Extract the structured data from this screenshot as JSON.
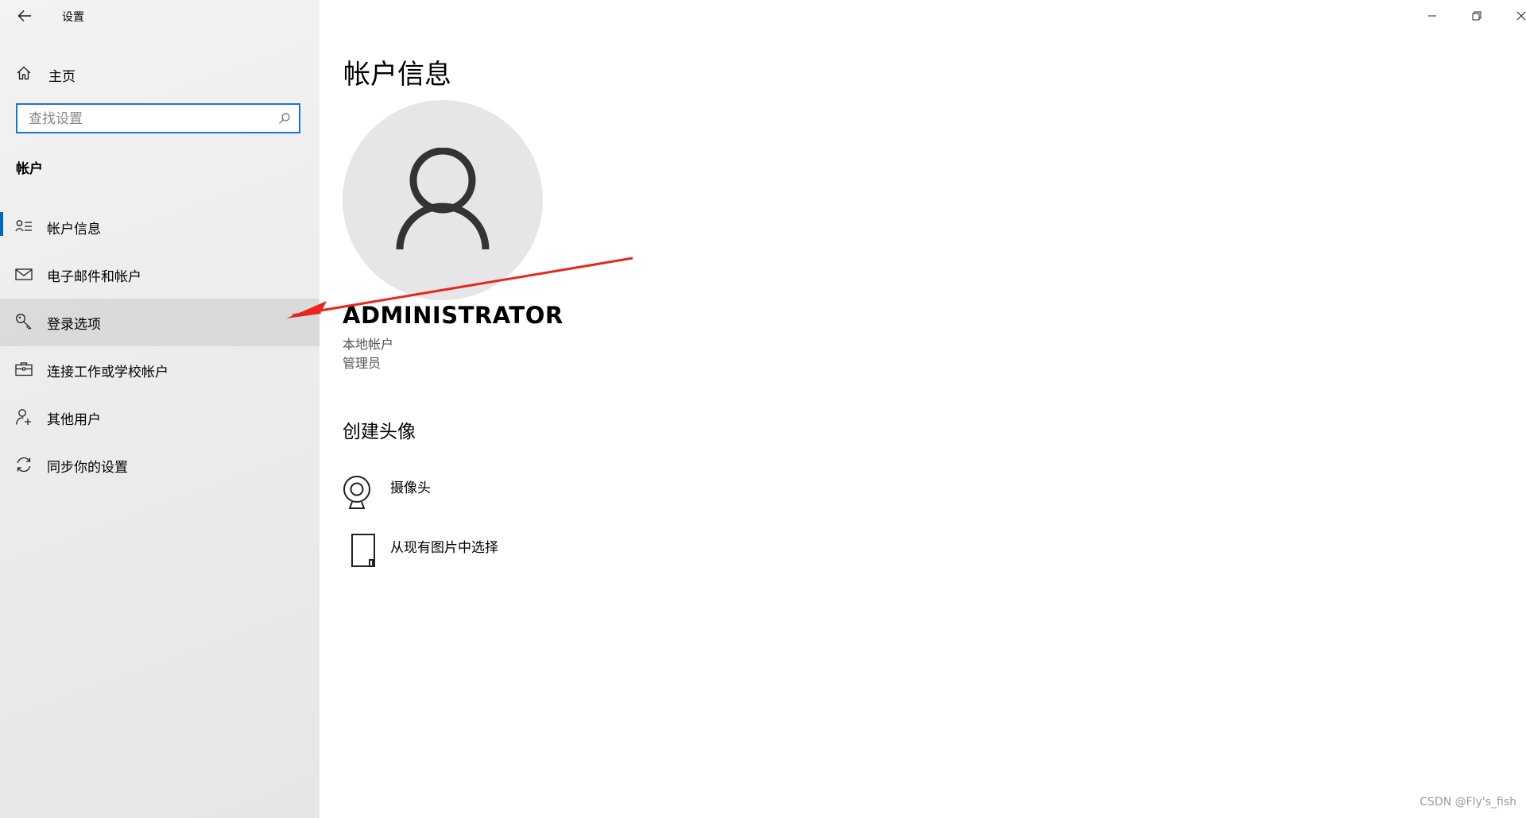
{
  "window": {
    "app_title": "设置",
    "controls": [
      "minimize-icon",
      "restore-icon",
      "close-icon"
    ]
  },
  "sidebar": {
    "home_label": "主页",
    "search": {
      "placeholder": "查找设置",
      "value": ""
    },
    "section_label": "帐户",
    "items": [
      {
        "label": "帐户信息",
        "icon": "account-info-icon",
        "selected": true
      },
      {
        "label": "电子邮件和帐户",
        "icon": "mail-icon"
      },
      {
        "label": "登录选项",
        "icon": "key-icon",
        "hover": true
      },
      {
        "label": "连接工作或学校帐户",
        "icon": "briefcase-icon"
      },
      {
        "label": "其他用户",
        "icon": "person-add-icon"
      },
      {
        "label": "同步你的设置",
        "icon": "sync-icon"
      }
    ]
  },
  "main": {
    "title": "帐户信息",
    "user": {
      "name": "ADMINISTRATOR",
      "account_type": "本地帐户",
      "role": "管理员"
    },
    "avatar_section": {
      "heading": "创建头像",
      "options": [
        {
          "label": "摄像头",
          "icon": "webcam-icon"
        },
        {
          "label": "从现有图片中选择",
          "icon": "picture-file-icon"
        }
      ]
    }
  },
  "watermark": "CSDN @Fly's_fish",
  "colors": {
    "accent": "#0067c0",
    "search_border": "#1a73d6",
    "annotation_arrow": "#e8261c",
    "sidebar_bg": "#eeeeee",
    "avatar_bg": "#e6e6e6"
  }
}
